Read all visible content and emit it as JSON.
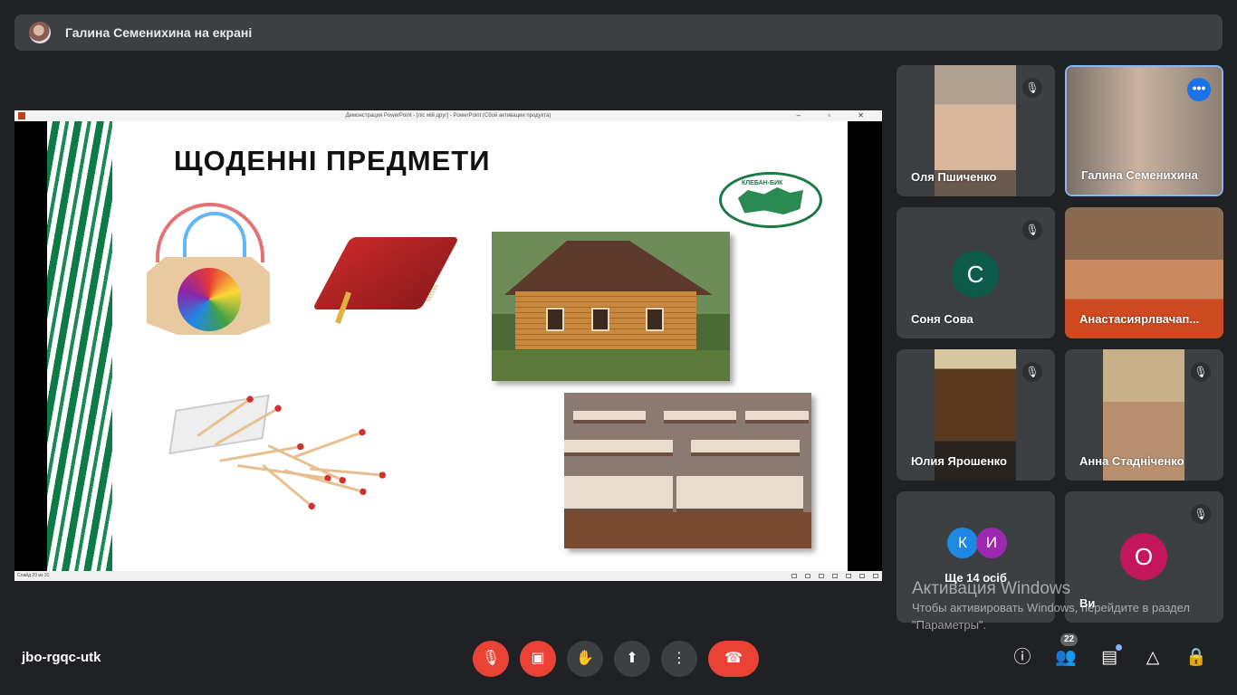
{
  "header": {
    "title": "Галина Семенихина на екрані"
  },
  "presentation": {
    "window_title": "Демонстрация PowerPoint - [ліс мій друг] - PowerPoint (Сбой активации продукта)",
    "window_controls": "– ▫ ✕",
    "status": "Слайд 20 из 31",
    "slide_title": "ЩОДЕННІ ПРЕДМЕТИ",
    "logo_text": "КЛЕБАН-БИК"
  },
  "tiles": [
    {
      "name": "Оля Пшиченко",
      "muted": true
    },
    {
      "name": "Галина Семенихина",
      "active": true
    },
    {
      "name": "Соня Сова",
      "initial": "С",
      "color": "#0d5c4a",
      "muted": true
    },
    {
      "name": "Анастасиярлвачап...",
      "muted": false
    },
    {
      "name": "Юлия Ярошенко",
      "muted": true
    },
    {
      "name": "Анна Стадніченко",
      "muted": true
    },
    {
      "more_label": "Ще 14 осіб",
      "initials": [
        "К",
        "И"
      ],
      "colors": [
        "#1e88e5",
        "#9c27b0"
      ]
    },
    {
      "name": "Ви",
      "initial": "О",
      "color": "#c2185b",
      "muted": true
    }
  ],
  "watermark": {
    "line1": "Активация Windows",
    "line2": "Чтобы активировать Windows, перейдите в раздел \"Параметры\"."
  },
  "bottom": {
    "meeting_code": "jbo-rgqc-utk",
    "participant_count": "22"
  },
  "icons": {
    "mic_off": "mic-off-icon",
    "cam_off": "camera-off-icon",
    "hand": "raise-hand-icon",
    "present": "present-screen-icon",
    "more": "more-vert-icon",
    "end": "end-call-icon",
    "info": "info-icon",
    "people": "people-icon",
    "chat": "chat-icon",
    "activities": "activities-icon",
    "lock": "host-controls-icon"
  }
}
